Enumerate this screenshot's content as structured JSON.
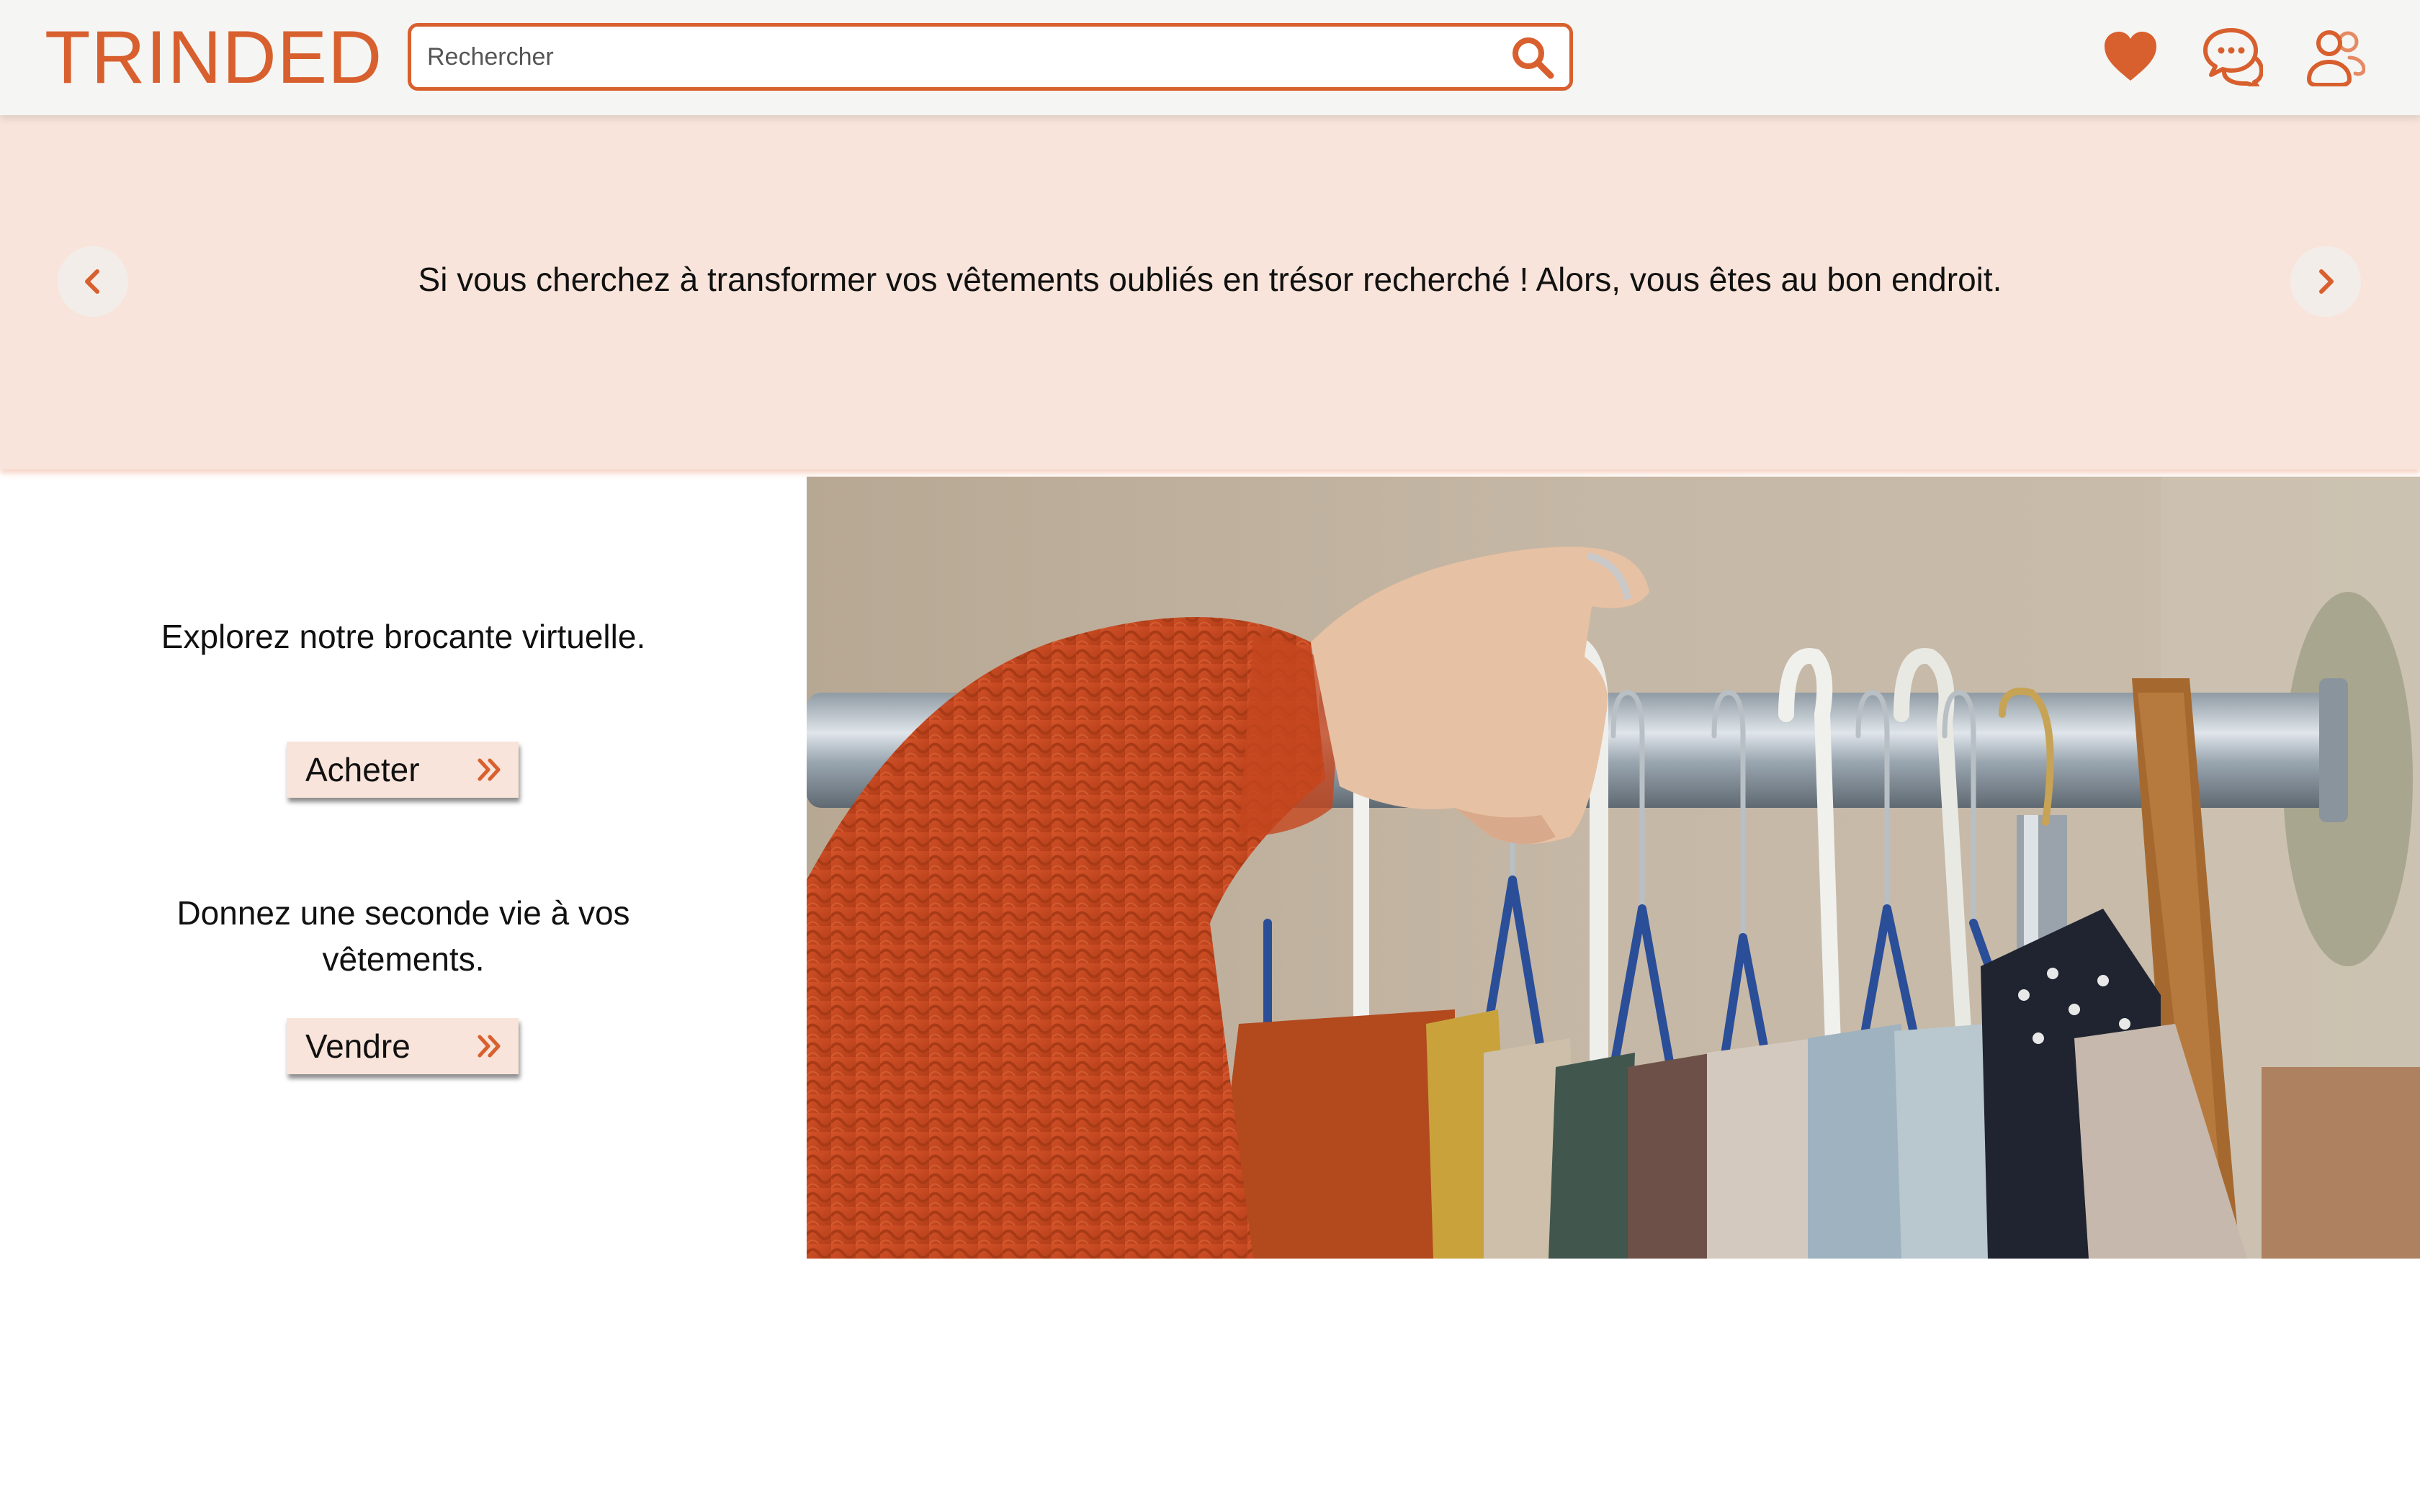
{
  "header": {
    "logo": "TRINDED",
    "search": {
      "placeholder": "Rechercher",
      "value": ""
    },
    "icons": [
      "search-icon",
      "heart-icon",
      "chat-icon",
      "user-icon"
    ]
  },
  "banner": {
    "message": "Si vous cherchez à transformer vos vêtements oubliés en trésor recherché ! Alors, vous êtes au bon endroit.",
    "icons": [
      "chevron-left-icon",
      "chevron-right-icon"
    ]
  },
  "main": {
    "buy": {
      "text": "Explorez notre brocante virtuelle.",
      "button_label": "Acheter"
    },
    "sell": {
      "text": "Donnez une seconde vie à vos vêtements.",
      "button_label": "Vendre"
    }
  },
  "colors": {
    "accent": "#d8602e",
    "banner_bg": "#f8e4da",
    "header_bg": "#f5f5f3"
  }
}
